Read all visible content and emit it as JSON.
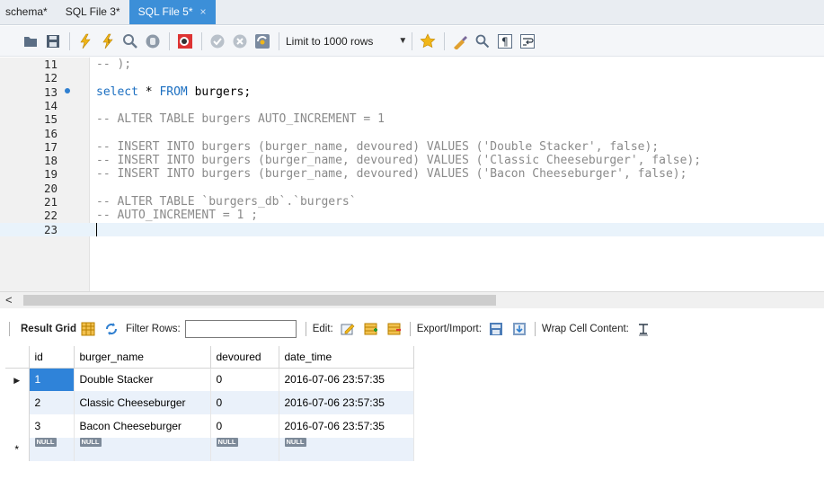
{
  "tabs": [
    {
      "label": "schema*",
      "active": false
    },
    {
      "label": "SQL File 3*",
      "active": false
    },
    {
      "label": "SQL File 5*",
      "active": true
    }
  ],
  "tab_close_glyph": "×",
  "toolbar": {
    "limit_label": "Limit to 1000 rows",
    "icons": [
      "open-folder-icon",
      "save-icon",
      "execute-icon",
      "execute-current-icon",
      "explain-icon",
      "stop-icon",
      "toggle-errors-icon",
      "commit-icon",
      "rollback-icon",
      "autocommit-icon",
      "beautify-icon",
      "find-icon",
      "invisible-chars-icon",
      "wrap-icon"
    ]
  },
  "editor": {
    "lines": [
      {
        "num": "11",
        "text": "-- );",
        "type": "comment"
      },
      {
        "num": "12",
        "text": "",
        "type": "plain"
      },
      {
        "num": "13",
        "text": "",
        "type": "select",
        "marker": true
      },
      {
        "num": "14",
        "text": "",
        "type": "plain"
      },
      {
        "num": "15",
        "text": "-- ALTER TABLE burgers AUTO_INCREMENT = 1",
        "type": "comment"
      },
      {
        "num": "16",
        "text": "",
        "type": "plain"
      },
      {
        "num": "17",
        "text": "-- INSERT INTO burgers (burger_name, devoured) VALUES ('Double Stacker', false);",
        "type": "comment"
      },
      {
        "num": "18",
        "text": "-- INSERT INTO burgers (burger_name, devoured) VALUES ('Classic Cheeseburger', false);",
        "type": "comment"
      },
      {
        "num": "19",
        "text": "-- INSERT INTO burgers (burger_name, devoured) VALUES ('Bacon Cheeseburger', false);",
        "type": "comment"
      },
      {
        "num": "20",
        "text": "",
        "type": "plain"
      },
      {
        "num": "21",
        "text": "-- ALTER TABLE `burgers_db`.`burgers`",
        "type": "comment"
      },
      {
        "num": "22",
        "text": "-- AUTO_INCREMENT = 1 ;",
        "type": "comment"
      },
      {
        "num": "23",
        "text": "",
        "type": "current"
      }
    ],
    "select_stmt": {
      "kw1": "select",
      "mid": " * ",
      "kw2": "FROM",
      "rest": " burgers;"
    }
  },
  "results": {
    "result_grid_label": "Result Grid",
    "filter_label": "Filter Rows:",
    "filter_value": "",
    "edit_label": "Edit:",
    "export_label": "Export/Import:",
    "wrap_label": "Wrap Cell Content:",
    "columns": [
      "id",
      "burger_name",
      "devoured",
      "date_time"
    ],
    "rows": [
      [
        "1",
        "Double Stacker",
        "0",
        "2016-07-06 23:57:35"
      ],
      [
        "2",
        "Classic Cheeseburger",
        "0",
        "2016-07-06 23:57:35"
      ],
      [
        "3",
        "Bacon Cheeseburger",
        "0",
        "2016-07-06 23:57:35"
      ]
    ],
    "null_badge": "NULL",
    "current_row_marker": "▶",
    "new_row_marker": "*"
  },
  "colors": {
    "accent": "#3c8fd8",
    "selection": "#2f83d9",
    "alt_row": "#eaf1fa",
    "keyword": "#1c6fc1",
    "comment": "#8a8a8a"
  }
}
